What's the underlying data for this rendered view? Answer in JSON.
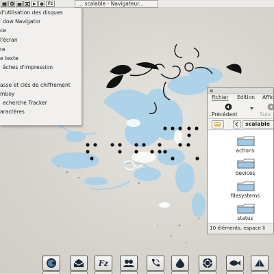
{
  "panel": {
    "launcher_icons": [
      "terminal-icon",
      "browser-icon",
      "files-icon",
      "media-icon",
      "network-icon",
      "fz-icon"
    ],
    "fz_label": "Fz",
    "task_title": "... scalable - Navigateur..."
  },
  "menu": {
    "items": [
      "d'utilisation des disques",
      "dow Navigator",
      "ce",
      "l'écran",
      "re",
      "e texte",
      "âches d'impression",
      "",
      "asse et clés de chiffrement",
      "mboy",
      "echerche Tracker",
      "aractères"
    ]
  },
  "file_manager": {
    "menubar": {
      "file": "Fichier",
      "edit": "Edition",
      "view": "Affic"
    },
    "toolbar": {
      "back": "Précédent",
      "forward": "Suiv"
    },
    "location": "scalable",
    "folders": [
      "actions",
      "devices",
      "filesystems",
      "status"
    ],
    "status": "10 éléments, espace li"
  },
  "dock": {
    "items": [
      "firefox-icon",
      "mail-icon",
      "fz-icon",
      "chat-icon",
      "phone-icon",
      "drop-icon",
      "aperture-icon",
      "fish-icon",
      "pyramid-icon"
    ],
    "fz_label": "Fz"
  },
  "colors": {
    "folder_blue": "#9fc7e6",
    "wallpaper_blue": "#a9d1ea",
    "panel_bg": "#ecebe8"
  }
}
